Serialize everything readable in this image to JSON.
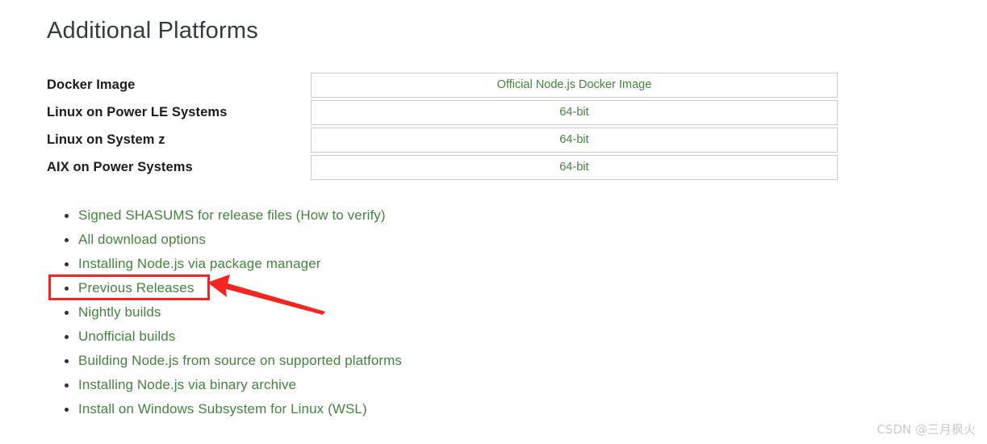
{
  "page": {
    "title": "Additional Platforms",
    "background_color": "#ffffff",
    "link_color": "#43853d",
    "title_color": "#333b45",
    "border_color": "#cccccc"
  },
  "platform_table": {
    "rows": [
      {
        "label": "Docker Image",
        "value": "Official Node.js Docker Image"
      },
      {
        "label": "Linux on Power LE Systems",
        "value": "64-bit"
      },
      {
        "label": "Linux on System z",
        "value": "64-bit"
      },
      {
        "label": "AIX on Power Systems",
        "value": "64-bit"
      }
    ]
  },
  "links": {
    "items": [
      {
        "label": "Signed SHASUMS for release files",
        "suffix_open": " (",
        "suffix_label": "How to verify",
        "suffix_close": ")"
      },
      {
        "label": "All download options"
      },
      {
        "label": "Installing Node.js via package manager"
      },
      {
        "label": "Previous Releases"
      },
      {
        "label": "Nightly builds"
      },
      {
        "label": "Unofficial builds"
      },
      {
        "label": "Building Node.js from source on supported platforms"
      },
      {
        "label": "Installing Node.js via binary archive"
      },
      {
        "label": "Install on Windows Subsystem for Linux (WSL)"
      }
    ]
  },
  "annotation": {
    "color": "#f5241f",
    "highlight_target": "Previous Releases",
    "shapes": [
      "highlight-rectangle",
      "pointer-arrow"
    ]
  },
  "watermark": {
    "text": "CSDN @三月枫火"
  }
}
